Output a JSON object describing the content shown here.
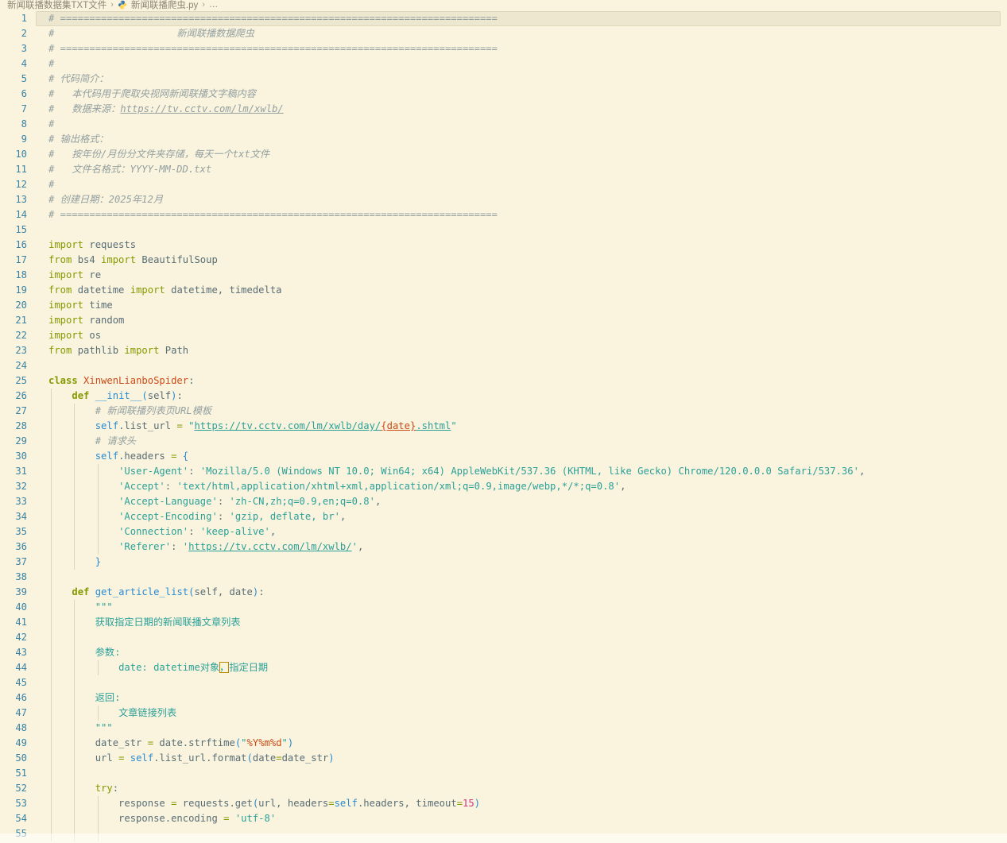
{
  "colors": {
    "background": "#faf3de",
    "line_highlight": "#eee7cf",
    "line_number": "#3883a5",
    "comment": "#93a1a1",
    "keyword": "#859900",
    "class_name": "#cb4b16",
    "function_name": "#268bd2",
    "string": "#2aa198",
    "number": "#d33682",
    "escape": "#cb4b16",
    "default_text": "#586e75",
    "unicode_highlight_border": "#b58900"
  },
  "breadcrumb": {
    "separator": "›",
    "items": [
      {
        "label": "新闻联播数据集TXT文件"
      },
      {
        "label": "新闻联播爬虫.py",
        "icon": "python-icon"
      },
      {
        "label": "…"
      }
    ]
  },
  "editor": {
    "language": "python",
    "current_line": 1,
    "first_visible_line": 1,
    "last_visible_line": 55,
    "lines": [
      {
        "n": 1,
        "hl": true,
        "g": 0,
        "seg": [
          [
            "cmt",
            "# ==========================================================================="
          ]
        ]
      },
      {
        "n": 2,
        "g": 0,
        "seg": [
          [
            "cmt",
            "#                     新闻联播数据爬虫"
          ]
        ]
      },
      {
        "n": 3,
        "g": 0,
        "seg": [
          [
            "cmt",
            "# ==========================================================================="
          ]
        ]
      },
      {
        "n": 4,
        "g": 0,
        "seg": [
          [
            "cmt",
            "#"
          ]
        ]
      },
      {
        "n": 5,
        "g": 0,
        "seg": [
          [
            "cmt",
            "# 代码简介："
          ]
        ]
      },
      {
        "n": 6,
        "g": 0,
        "seg": [
          [
            "cmt",
            "#   本代码用于爬取央视网新闻联播文字稿内容"
          ]
        ]
      },
      {
        "n": 7,
        "g": 0,
        "seg": [
          [
            "cmt",
            "#   数据来源："
          ],
          [
            "cmtu",
            "https://tv.cctv.com/lm/xwlb/"
          ]
        ]
      },
      {
        "n": 8,
        "g": 0,
        "seg": [
          [
            "cmt",
            "#"
          ]
        ]
      },
      {
        "n": 9,
        "g": 0,
        "seg": [
          [
            "cmt",
            "# 输出格式："
          ]
        ]
      },
      {
        "n": 10,
        "g": 0,
        "seg": [
          [
            "cmt",
            "#   按年份/月份分文件夹存储，每天一个txt文件"
          ]
        ]
      },
      {
        "n": 11,
        "g": 0,
        "seg": [
          [
            "cmt",
            "#   文件名格式：YYYY-MM-DD.txt"
          ]
        ]
      },
      {
        "n": 12,
        "g": 0,
        "seg": [
          [
            "cmt",
            "#"
          ]
        ]
      },
      {
        "n": 13,
        "g": 0,
        "seg": [
          [
            "cmt",
            "# 创建日期：2025年12月"
          ]
        ]
      },
      {
        "n": 14,
        "g": 0,
        "seg": [
          [
            "cmt",
            "# ==========================================================================="
          ]
        ]
      },
      {
        "n": 15,
        "g": 0,
        "seg": []
      },
      {
        "n": 16,
        "g": 0,
        "seg": [
          [
            "kw",
            "import"
          ],
          [
            "txt",
            " requests"
          ]
        ]
      },
      {
        "n": 17,
        "g": 0,
        "seg": [
          [
            "kw",
            "from"
          ],
          [
            "txt",
            " bs4 "
          ],
          [
            "kw",
            "import"
          ],
          [
            "txt",
            " BeautifulSoup"
          ]
        ]
      },
      {
        "n": 18,
        "g": 0,
        "seg": [
          [
            "kw",
            "import"
          ],
          [
            "txt",
            " re"
          ]
        ]
      },
      {
        "n": 19,
        "g": 0,
        "seg": [
          [
            "kw",
            "from"
          ],
          [
            "txt",
            " datetime "
          ],
          [
            "kw",
            "import"
          ],
          [
            "txt",
            " datetime, timedelta"
          ]
        ]
      },
      {
        "n": 20,
        "g": 0,
        "seg": [
          [
            "kw",
            "import"
          ],
          [
            "txt",
            " time"
          ]
        ]
      },
      {
        "n": 21,
        "g": 0,
        "seg": [
          [
            "kw",
            "import"
          ],
          [
            "txt",
            " random"
          ]
        ]
      },
      {
        "n": 22,
        "g": 0,
        "seg": [
          [
            "kw",
            "import"
          ],
          [
            "txt",
            " os"
          ]
        ]
      },
      {
        "n": 23,
        "g": 0,
        "seg": [
          [
            "kw",
            "from"
          ],
          [
            "txt",
            " pathlib "
          ],
          [
            "kw",
            "import"
          ],
          [
            "txt",
            " Path"
          ]
        ]
      },
      {
        "n": 24,
        "g": 0,
        "seg": []
      },
      {
        "n": 25,
        "g": 0,
        "seg": [
          [
            "kwb",
            "class"
          ],
          [
            "txt",
            " "
          ],
          [
            "cls",
            "XinwenLianboSpider"
          ],
          [
            "txt",
            ":"
          ]
        ]
      },
      {
        "n": 26,
        "g": 1,
        "seg": [
          [
            "txt",
            "    "
          ],
          [
            "kwb",
            "def"
          ],
          [
            "txt",
            " "
          ],
          [
            "fn",
            "__init__"
          ],
          [
            "pb",
            "("
          ],
          [
            "txt",
            "self"
          ],
          [
            "pb",
            ")"
          ],
          [
            "txt",
            ":"
          ]
        ]
      },
      {
        "n": 27,
        "g": 2,
        "seg": [
          [
            "txt",
            "        "
          ],
          [
            "cmt",
            "# 新闻联播列表页URL模板"
          ]
        ]
      },
      {
        "n": 28,
        "g": 2,
        "seg": [
          [
            "txt",
            "        "
          ],
          [
            "slf",
            "self"
          ],
          [
            "txt",
            ".list_url "
          ],
          [
            "op",
            "="
          ],
          [
            "txt",
            " "
          ],
          [
            "str",
            "\""
          ],
          [
            "stru",
            "https://tv.cctv.com/lm/xwlb/day/"
          ],
          [
            "escu",
            "{date}"
          ],
          [
            "stru",
            ".shtml"
          ],
          [
            "str",
            "\""
          ]
        ]
      },
      {
        "n": 29,
        "g": 2,
        "seg": [
          [
            "txt",
            "        "
          ],
          [
            "cmt",
            "# 请求头"
          ]
        ]
      },
      {
        "n": 30,
        "g": 2,
        "seg": [
          [
            "txt",
            "        "
          ],
          [
            "slf",
            "self"
          ],
          [
            "txt",
            ".headers "
          ],
          [
            "op",
            "="
          ],
          [
            "txt",
            " "
          ],
          [
            "pb",
            "{"
          ]
        ]
      },
      {
        "n": 31,
        "g": 3,
        "seg": [
          [
            "txt",
            "            "
          ],
          [
            "str",
            "'User-Agent'"
          ],
          [
            "txt",
            ": "
          ],
          [
            "str",
            "'Mozilla/5.0 (Windows NT 10.0; Win64; x64) AppleWebKit/537.36 (KHTML, like Gecko) Chrome/120.0.0.0 Safari/537.36'"
          ],
          [
            "txt",
            ","
          ]
        ]
      },
      {
        "n": 32,
        "g": 3,
        "seg": [
          [
            "txt",
            "            "
          ],
          [
            "str",
            "'Accept'"
          ],
          [
            "txt",
            ": "
          ],
          [
            "str",
            "'text/html,application/xhtml+xml,application/xml;q=0.9,image/webp,*/*;q=0.8'"
          ],
          [
            "txt",
            ","
          ]
        ]
      },
      {
        "n": 33,
        "g": 3,
        "seg": [
          [
            "txt",
            "            "
          ],
          [
            "str",
            "'Accept-Language'"
          ],
          [
            "txt",
            ": "
          ],
          [
            "str",
            "'zh-CN,zh;q=0.9,en;q=0.8'"
          ],
          [
            "txt",
            ","
          ]
        ]
      },
      {
        "n": 34,
        "g": 3,
        "seg": [
          [
            "txt",
            "            "
          ],
          [
            "str",
            "'Accept-Encoding'"
          ],
          [
            "txt",
            ": "
          ],
          [
            "str",
            "'gzip, deflate, br'"
          ],
          [
            "txt",
            ","
          ]
        ]
      },
      {
        "n": 35,
        "g": 3,
        "seg": [
          [
            "txt",
            "            "
          ],
          [
            "str",
            "'Connection'"
          ],
          [
            "txt",
            ": "
          ],
          [
            "str",
            "'keep-alive'"
          ],
          [
            "txt",
            ","
          ]
        ]
      },
      {
        "n": 36,
        "g": 3,
        "seg": [
          [
            "txt",
            "            "
          ],
          [
            "str",
            "'Referer'"
          ],
          [
            "txt",
            ": "
          ],
          [
            "str",
            "'"
          ],
          [
            "stru",
            "https://tv.cctv.com/lm/xwlb/"
          ],
          [
            "str",
            "'"
          ],
          [
            "txt",
            ","
          ]
        ]
      },
      {
        "n": 37,
        "g": 2,
        "seg": [
          [
            "txt",
            "        "
          ],
          [
            "pb",
            "}"
          ]
        ]
      },
      {
        "n": 38,
        "g": 1,
        "seg": []
      },
      {
        "n": 39,
        "g": 1,
        "seg": [
          [
            "txt",
            "    "
          ],
          [
            "kwb",
            "def"
          ],
          [
            "txt",
            " "
          ],
          [
            "fn",
            "get_article_list"
          ],
          [
            "pb",
            "("
          ],
          [
            "txt",
            "self, date"
          ],
          [
            "pb",
            ")"
          ],
          [
            "txt",
            ":"
          ]
        ]
      },
      {
        "n": 40,
        "g": 2,
        "seg": [
          [
            "txt",
            "        "
          ],
          [
            "str",
            "\"\"\""
          ]
        ]
      },
      {
        "n": 41,
        "g": 2,
        "seg": [
          [
            "txt",
            "        "
          ],
          [
            "str",
            "获取指定日期的新闻联播文章列表"
          ]
        ]
      },
      {
        "n": 42,
        "g": 2,
        "seg": []
      },
      {
        "n": 43,
        "g": 2,
        "seg": [
          [
            "txt",
            "        "
          ],
          [
            "str",
            "参数:"
          ]
        ]
      },
      {
        "n": 44,
        "g": 3,
        "seg": [
          [
            "txt",
            "            "
          ],
          [
            "str",
            "date: datetime对象"
          ],
          [
            "strbox",
            "，"
          ],
          [
            "str",
            "指定日期"
          ]
        ]
      },
      {
        "n": 45,
        "g": 2,
        "seg": []
      },
      {
        "n": 46,
        "g": 2,
        "seg": [
          [
            "txt",
            "        "
          ],
          [
            "str",
            "返回:"
          ]
        ]
      },
      {
        "n": 47,
        "g": 3,
        "seg": [
          [
            "txt",
            "            "
          ],
          [
            "str",
            "文章链接列表"
          ]
        ]
      },
      {
        "n": 48,
        "g": 2,
        "seg": [
          [
            "txt",
            "        "
          ],
          [
            "str",
            "\"\"\""
          ]
        ]
      },
      {
        "n": 49,
        "g": 2,
        "seg": [
          [
            "txt",
            "        date_str "
          ],
          [
            "op",
            "="
          ],
          [
            "txt",
            " date.strftime"
          ],
          [
            "pb",
            "("
          ],
          [
            "str",
            "\""
          ],
          [
            "esc",
            "%Y%m%d"
          ],
          [
            "str",
            "\""
          ],
          [
            "pb",
            ")"
          ]
        ]
      },
      {
        "n": 50,
        "g": 2,
        "seg": [
          [
            "txt",
            "        url "
          ],
          [
            "op",
            "="
          ],
          [
            "txt",
            " "
          ],
          [
            "slf",
            "self"
          ],
          [
            "txt",
            ".list_url.format"
          ],
          [
            "pb",
            "("
          ],
          [
            "txt",
            "date"
          ],
          [
            "op",
            "="
          ],
          [
            "txt",
            "date_str"
          ],
          [
            "pb",
            ")"
          ]
        ]
      },
      {
        "n": 51,
        "g": 2,
        "seg": []
      },
      {
        "n": 52,
        "g": 2,
        "seg": [
          [
            "txt",
            "        "
          ],
          [
            "kw",
            "try"
          ],
          [
            "txt",
            ":"
          ]
        ]
      },
      {
        "n": 53,
        "g": 3,
        "seg": [
          [
            "txt",
            "            response "
          ],
          [
            "op",
            "="
          ],
          [
            "txt",
            " requests.get"
          ],
          [
            "pb",
            "("
          ],
          [
            "txt",
            "url, headers"
          ],
          [
            "op",
            "="
          ],
          [
            "slf",
            "self"
          ],
          [
            "txt",
            ".headers, timeout"
          ],
          [
            "op",
            "="
          ],
          [
            "num",
            "15"
          ],
          [
            "pb",
            ")"
          ]
        ]
      },
      {
        "n": 54,
        "g": 3,
        "seg": [
          [
            "txt",
            "            response.encoding "
          ],
          [
            "op",
            "="
          ],
          [
            "txt",
            " "
          ],
          [
            "str",
            "'utf-8'"
          ]
        ]
      },
      {
        "n": 55,
        "g": 3,
        "seg": []
      }
    ]
  }
}
